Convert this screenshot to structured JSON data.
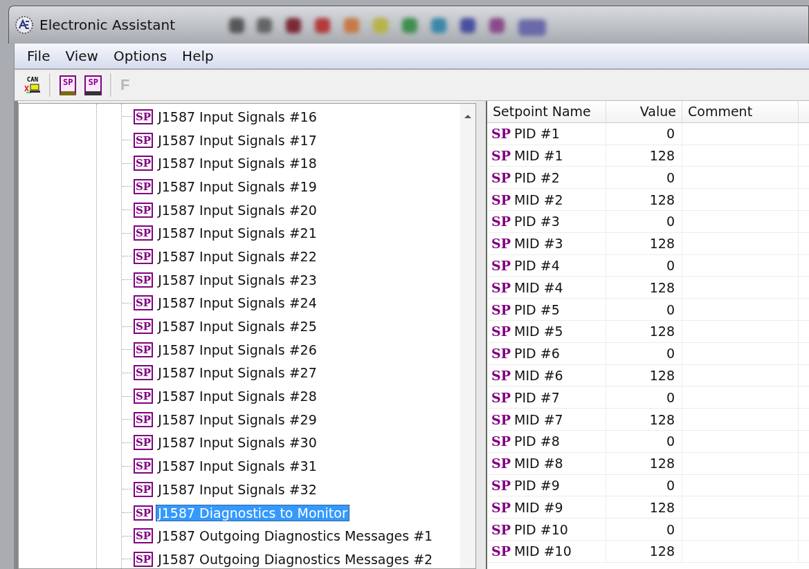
{
  "window": {
    "title": "Electronic Assistant"
  },
  "menu": [
    {
      "label": "File"
    },
    {
      "label": "View"
    },
    {
      "label": "Options"
    },
    {
      "label": "Help"
    }
  ],
  "toolbar": [
    {
      "kind": "can",
      "text": "CAN",
      "disabled": false
    },
    {
      "kind": "open",
      "text": "SP",
      "disabled": false
    },
    {
      "kind": "save",
      "text": "SP",
      "disabled": false
    },
    {
      "kind": "letter",
      "text": "F",
      "disabled": true
    }
  ],
  "tree": {
    "items": [
      {
        "badge": "SP",
        "label": "J1587 Input Signals #16",
        "selected": false
      },
      {
        "badge": "SP",
        "label": "J1587 Input Signals #17",
        "selected": false
      },
      {
        "badge": "SP",
        "label": "J1587 Input Signals #18",
        "selected": false
      },
      {
        "badge": "SP",
        "label": "J1587 Input Signals #19",
        "selected": false
      },
      {
        "badge": "SP",
        "label": "J1587 Input Signals #20",
        "selected": false
      },
      {
        "badge": "SP",
        "label": "J1587 Input Signals #21",
        "selected": false
      },
      {
        "badge": "SP",
        "label": "J1587 Input Signals #22",
        "selected": false
      },
      {
        "badge": "SP",
        "label": "J1587 Input Signals #23",
        "selected": false
      },
      {
        "badge": "SP",
        "label": "J1587 Input Signals #24",
        "selected": false
      },
      {
        "badge": "SP",
        "label": "J1587 Input Signals #25",
        "selected": false
      },
      {
        "badge": "SP",
        "label": "J1587 Input Signals #26",
        "selected": false
      },
      {
        "badge": "SP",
        "label": "J1587 Input Signals #27",
        "selected": false
      },
      {
        "badge": "SP",
        "label": "J1587 Input Signals #28",
        "selected": false
      },
      {
        "badge": "SP",
        "label": "J1587 Input Signals #29",
        "selected": false
      },
      {
        "badge": "SP",
        "label": "J1587 Input Signals #30",
        "selected": false
      },
      {
        "badge": "SP",
        "label": "J1587 Input Signals #31",
        "selected": false
      },
      {
        "badge": "SP",
        "label": "J1587 Input Signals #32",
        "selected": false
      },
      {
        "badge": "SP",
        "label": "J1587 Diagnostics to Monitor",
        "selected": true
      },
      {
        "badge": "SP",
        "label": "J1587 Outgoing Diagnostics Messages #1",
        "selected": false
      },
      {
        "badge": "SP",
        "label": "J1587 Outgoing Diagnostics Messages #2",
        "selected": false
      }
    ]
  },
  "table": {
    "columns": [
      "Setpoint Name",
      "Value",
      "Comment"
    ],
    "rows": [
      {
        "badge": "SP",
        "name": "PID #1",
        "value": "0"
      },
      {
        "badge": "SP",
        "name": "MID #1",
        "value": "128"
      },
      {
        "badge": "SP",
        "name": "PID #2",
        "value": "0"
      },
      {
        "badge": "SP",
        "name": "MID #2",
        "value": "128"
      },
      {
        "badge": "SP",
        "name": "PID #3",
        "value": "0"
      },
      {
        "badge": "SP",
        "name": "MID #3",
        "value": "128"
      },
      {
        "badge": "SP",
        "name": "PID #4",
        "value": "0"
      },
      {
        "badge": "SP",
        "name": "MID #4",
        "value": "128"
      },
      {
        "badge": "SP",
        "name": "PID #5",
        "value": "0"
      },
      {
        "badge": "SP",
        "name": "MID #5",
        "value": "128"
      },
      {
        "badge": "SP",
        "name": "PID #6",
        "value": "0"
      },
      {
        "badge": "SP",
        "name": "MID #6",
        "value": "128"
      },
      {
        "badge": "SP",
        "name": "PID #7",
        "value": "0"
      },
      {
        "badge": "SP",
        "name": "MID #7",
        "value": "128"
      },
      {
        "badge": "SP",
        "name": "PID #8",
        "value": "0"
      },
      {
        "badge": "SP",
        "name": "MID #8",
        "value": "128"
      },
      {
        "badge": "SP",
        "name": "PID #9",
        "value": "0"
      },
      {
        "badge": "SP",
        "name": "MID #9",
        "value": "128"
      },
      {
        "badge": "SP",
        "name": "PID #10",
        "value": "0"
      },
      {
        "badge": "SP",
        "name": "MID #10",
        "value": "128"
      }
    ]
  }
}
